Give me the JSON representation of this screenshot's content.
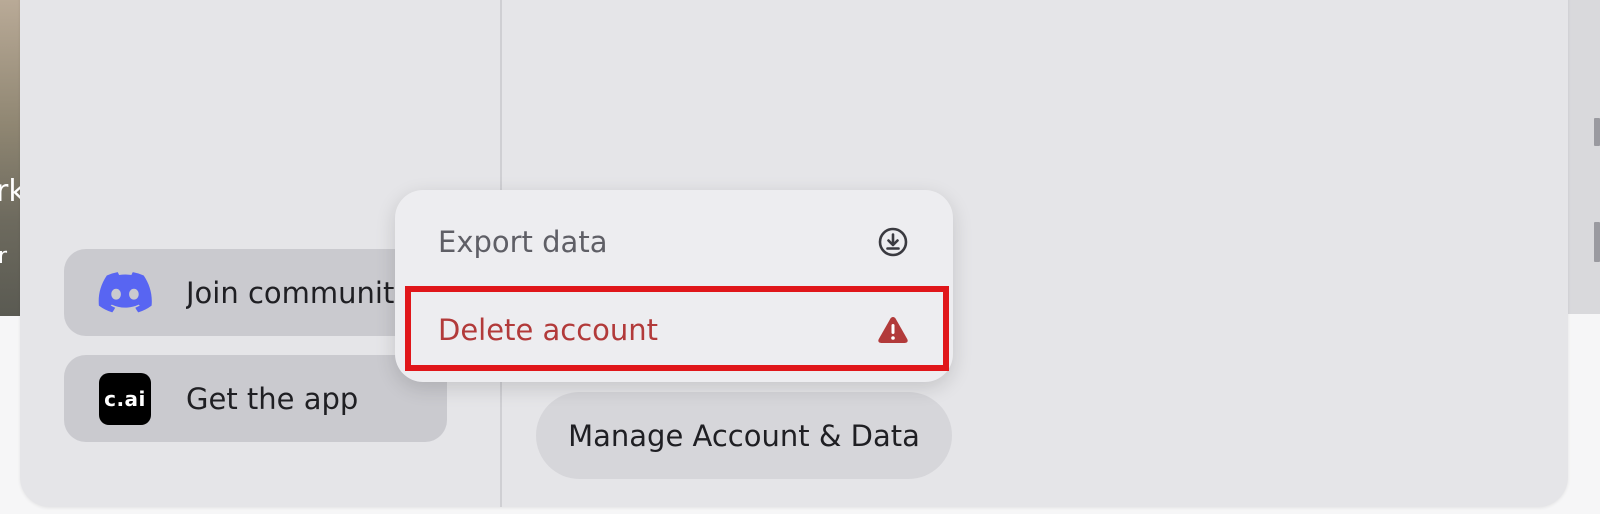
{
  "background": {
    "left_text_1": "rk",
    "left_text_2": "r"
  },
  "sidebar": {
    "community_label": "Join community",
    "app_label": "Get the app",
    "app_logo_text": "c.ai",
    "community_icon": "discord-icon"
  },
  "main": {
    "manage_button_label": "Manage Account & Data"
  },
  "menu": {
    "items": [
      {
        "label": "Export data",
        "icon": "download-icon"
      },
      {
        "label": "Delete account",
        "icon": "warning-icon"
      }
    ]
  },
  "colors": {
    "danger": "#b23a3a",
    "highlight": "#e0161a",
    "discord": "#5865f2"
  }
}
